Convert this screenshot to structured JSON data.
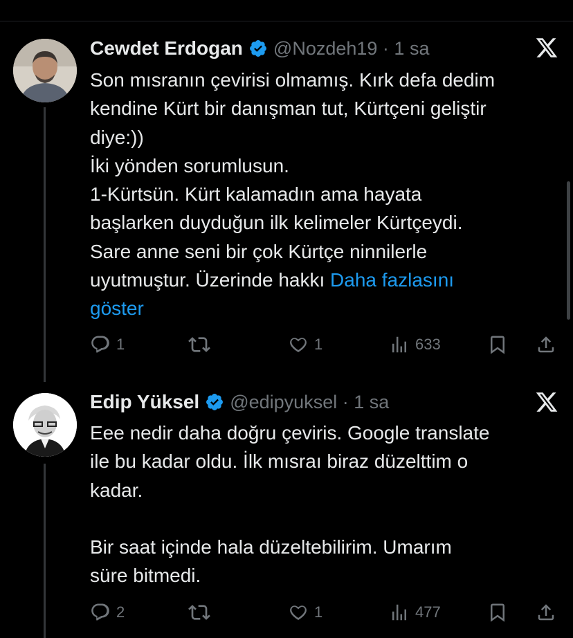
{
  "tweets": [
    {
      "name": "Cewdet Erdogan",
      "handle_time": "@Nozdeh19 · 1 sa",
      "lines": [
        "Son mısranın çevirisi olmamış. Kırk defa dedim",
        "kendine Kürt bir danışman tut, Kürtçeni geliştir",
        "diye:))",
        "İki yönden sorumlusun.",
        "1-Kürtsün. Kürt kalamadın ama hayata",
        "başlarken duyduğun ilk kelimeler Kürtçeydi.",
        "Sare anne seni bir çok Kürtçe ninnilerle"
      ],
      "last_line_text": "uyutmuştur. Üzerinde hakkı ",
      "show_more": "Daha fazlasını",
      "show_more_2": "göster",
      "replies": "1",
      "retweets": "",
      "likes": "1",
      "views": "633"
    },
    {
      "name": "Edip Yüksel",
      "handle_time": "@edipyuksel · 1 sa",
      "lines": [
        "Eee nedir daha doğru çeviris. Google translate",
        "ile bu kadar oldu. İlk mısraı biraz düzelttim o",
        "kadar."
      ],
      "lines_2": [
        "Bir saat içinde hala düzeltebilirim. Umarım",
        "süre bitmedi."
      ],
      "replies": "2",
      "retweets": "",
      "likes": "1",
      "views": "477"
    }
  ],
  "colors": {
    "background": "#000000",
    "text": "#e7e9ea",
    "muted": "#71767b",
    "link": "#1d9bf0",
    "verified": "#1d9bf0"
  },
  "icons": [
    "verified-badge-icon",
    "x-logo-icon",
    "reply-icon",
    "retweet-icon",
    "like-icon",
    "views-icon",
    "bookmark-icon",
    "share-icon"
  ]
}
